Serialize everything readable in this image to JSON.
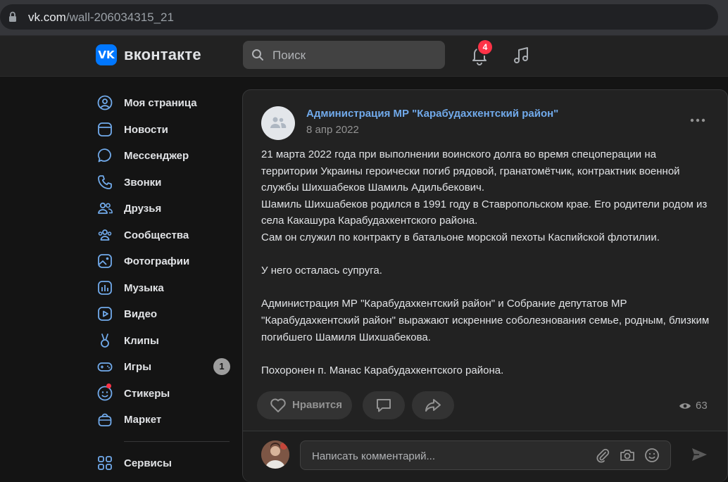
{
  "browser": {
    "url_host": "vk.com",
    "url_path": "/wall-206034315_21"
  },
  "header": {
    "logo_text": "вконтакте",
    "logo_mark": "VK",
    "search_placeholder": "Поиск",
    "notifications_count": "4"
  },
  "sidebar": {
    "items": [
      {
        "label": "Моя страница",
        "icon": "user-circle-icon"
      },
      {
        "label": "Новости",
        "icon": "newsfeed-icon"
      },
      {
        "label": "Мессенджер",
        "icon": "message-icon"
      },
      {
        "label": "Звонки",
        "icon": "phone-icon"
      },
      {
        "label": "Друзья",
        "icon": "friends-icon"
      },
      {
        "label": "Сообщества",
        "icon": "communities-icon"
      },
      {
        "label": "Фотографии",
        "icon": "photo-icon"
      },
      {
        "label": "Музыка",
        "icon": "music-icon"
      },
      {
        "label": "Видео",
        "icon": "video-icon"
      },
      {
        "label": "Клипы",
        "icon": "clips-icon"
      },
      {
        "label": "Игры",
        "icon": "gamepad-icon",
        "count": "1"
      },
      {
        "label": "Стикеры",
        "icon": "sticker-icon"
      },
      {
        "label": "Маркет",
        "icon": "market-icon"
      },
      {
        "label": "Сервисы",
        "icon": "services-icon"
      }
    ]
  },
  "post": {
    "author": "Администрация МР \"Карабудахкентский район\"",
    "date": "8 апр 2022",
    "paragraphs": [
      "21 марта 2022 года при выполнении воинского долга во время спецоперации на территории Украины героически погиб рядовой, гранатомётчик, контрактник военной службы Шихшабеков Шамиль Адильбекович.",
      "Шамиль Шихшабеков родился в 1991 году в Ставропольском крае. Его родители родом из села Какашура Карабудахкентского района.",
      "Сам он служил по контракту в батальоне морской пехоты Каспийской флотилии.",
      "",
      "У него осталась супруга.",
      "",
      "Администрация МР \"Карабудахкентский район\" и Собрание депутатов МР \"Карабудахкентский район\" выражают искренние соболезнования семье, родным, близким погибшего Шамиля Шихшабекова.",
      "",
      "Похоронен п. Манас Карабудахкентского района."
    ],
    "like_label": "Нравится",
    "views": "63",
    "comment_placeholder": "Написать комментарий..."
  },
  "colors": {
    "accent": "#71aaeb",
    "brand": "#0077ff",
    "badge": "#ff3347"
  }
}
